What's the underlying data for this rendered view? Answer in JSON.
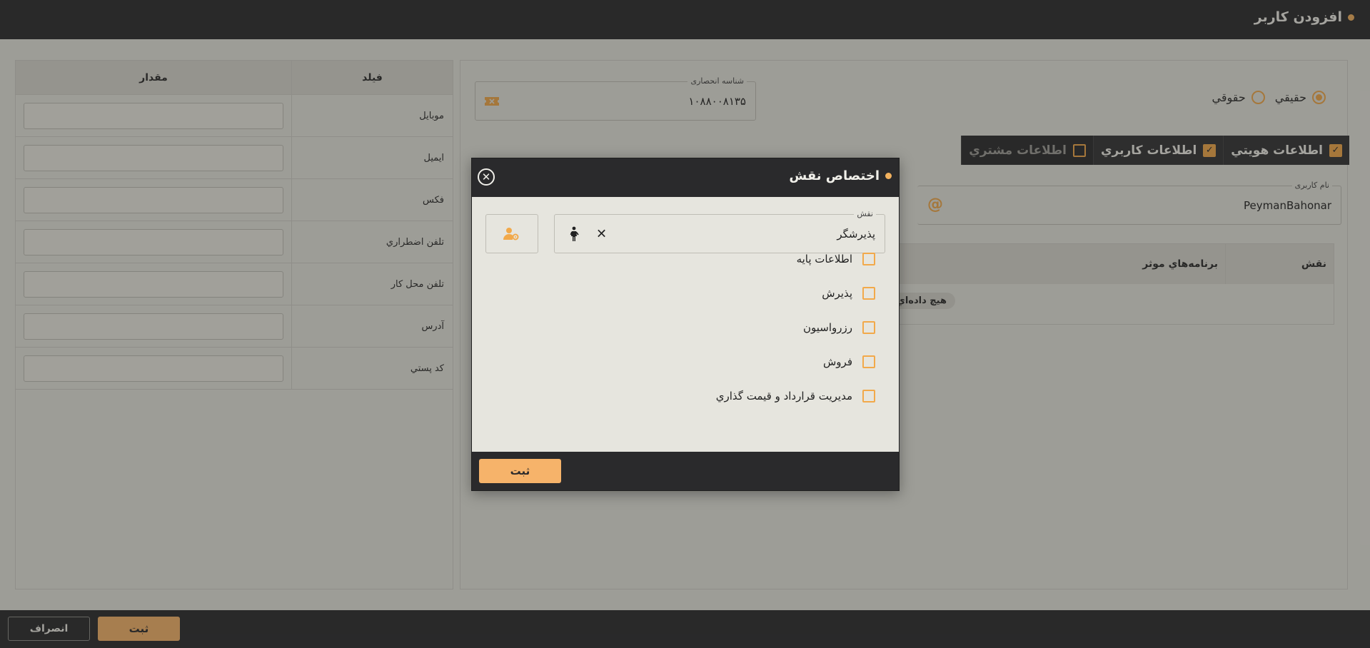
{
  "header": {
    "title": "افزودن کاربر"
  },
  "footer": {
    "submit_label": "ثبت",
    "cancel_label": "انصراف"
  },
  "fields_table": {
    "headers": {
      "field": "فیلد",
      "value": "مقدار"
    },
    "rows": [
      {
        "label": "موبايل",
        "value": ""
      },
      {
        "label": "ايميل",
        "value": ""
      },
      {
        "label": "فکس",
        "value": ""
      },
      {
        "label": "تلفن اضطراري",
        "value": ""
      },
      {
        "label": "تلفن محل کار",
        "value": ""
      },
      {
        "label": "آدرس",
        "value": ""
      },
      {
        "label": "کد پستي",
        "value": ""
      }
    ]
  },
  "person_type": {
    "options": [
      {
        "label": "حقيقي",
        "selected": true
      },
      {
        "label": "حقوقي",
        "selected": false
      }
    ]
  },
  "unique_id": {
    "legend": "شناسه انحصاری",
    "value": "۱۰۸۸۰۰۸۱۳۵"
  },
  "tabs": [
    {
      "label": "اطلاعات هويتي",
      "checked": true
    },
    {
      "label": "اطلاعات کاربري",
      "checked": true
    },
    {
      "label": "اطلاعات مشتري",
      "checked": false
    }
  ],
  "username": {
    "legend": "نام کاربری",
    "value": "PeymanBahonar"
  },
  "roles_grid": {
    "headers": {
      "role": "نقش",
      "programs": "برنامه‌هاي موثر"
    },
    "empty_text": "هيچ داده‌اي پ"
  },
  "modal": {
    "title": "اختصاص نقش",
    "role_field": {
      "legend": "نقش",
      "value": "پذيرشگر"
    },
    "permissions": [
      {
        "label": "اطلاعات پايه",
        "checked": false
      },
      {
        "label": "پذيرش",
        "checked": false
      },
      {
        "label": "رزرواسيون",
        "checked": false
      },
      {
        "label": "فروش",
        "checked": false
      },
      {
        "label": "مديريت قرارداد و قيمت گذاري",
        "checked": false
      }
    ],
    "submit_label": "ثبت"
  },
  "colors": {
    "accent": "#f2a94a",
    "dark": "#2a2a2c",
    "surface": "#e6e5de"
  }
}
